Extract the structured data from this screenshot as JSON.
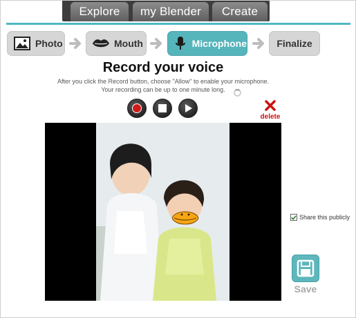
{
  "nav": {
    "tabs": [
      {
        "label": "Explore"
      },
      {
        "label": "my Blender"
      },
      {
        "label": "Create"
      }
    ]
  },
  "steps": [
    {
      "label": "Photo",
      "icon": "image-icon",
      "active": false
    },
    {
      "label": "Mouth",
      "icon": "lips-icon",
      "active": false
    },
    {
      "label": "Microphone",
      "icon": "microphone-icon",
      "active": true
    },
    {
      "label": "Finalize",
      "icon": "",
      "active": false
    }
  ],
  "colors": {
    "accent": "#56b4bb",
    "record": "#d11a1a",
    "delete": "#cc1111"
  },
  "main": {
    "title": "Record your voice",
    "instruction_line1": "After you click the Record button, choose \"Allow\" to enable your microphone.",
    "instruction_line2": "Your recording can be up to one minute long."
  },
  "controls": {
    "record_icon": "record-icon",
    "stop_icon": "stop-icon",
    "play_icon": "play-icon",
    "delete_label": "delete"
  },
  "share": {
    "label": "Share this publicly",
    "checked": true
  },
  "save": {
    "label": "Save"
  }
}
